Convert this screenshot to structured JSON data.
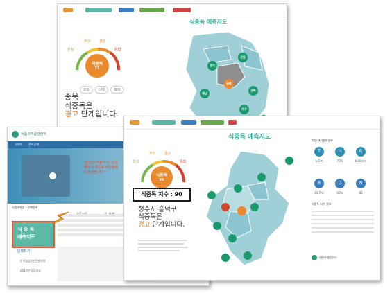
{
  "window_back": {
    "map_title": "식중독 예측지도",
    "gauge_labels": [
      "관심",
      "주의",
      "경고",
      "위험"
    ],
    "dial_text": "식중독",
    "dial_value": "71",
    "tabs": [
      "오늘",
      "내일",
      "모레"
    ],
    "region": "충북",
    "headline": "식중독은",
    "status": "경고",
    "status_tail": "단계입니다.",
    "nodes": [
      "강원",
      "경기",
      "충북",
      "충남",
      "경북",
      "대구",
      "울산"
    ]
  },
  "window_left": {
    "site_name": "식품의약품안전처",
    "nav": [
      "식약처",
      "정보공개"
    ],
    "banner_line1": "\"안전한 먹을거리, 건강",
    "banner_line2": "좋은 환경으로 국민행복",
    "banner_line3": "이끌겠습니다.\"",
    "tile_label1": "식 중 독",
    "tile_label2": "예측지도",
    "section_title": "식품의약품 / 정책정보",
    "news_tabs": [
      "보도자료",
      "공지사항"
    ],
    "alert_title": "알레르기",
    "links": [
      "한국농업인안전관리원",
      "2016년 업무보고"
    ]
  },
  "window_front": {
    "map_title": "식중독 예측지도",
    "gauge_labels": [
      "관심",
      "주의",
      "경고",
      "위험"
    ],
    "dial_text": "식중독",
    "dial_value": "90",
    "index_badge": "식중독 지수 : 90",
    "region": "청주시 흥덕구",
    "headline": "식중독은",
    "status": "경고",
    "status_tail": "단계입니다.",
    "env_title": "기상/대기환경정보",
    "env_values": [
      "1.5℃",
      "73%",
      "0.00mm"
    ],
    "env_values2": [
      "43.7℃",
      "62%",
      "83"
    ],
    "guide_title": "식중독 지수 정보",
    "footer": "식품의약품안전처"
  },
  "colors": {
    "map_fill": "#9fd0d8",
    "node_green": "#1a9a6c",
    "node_orange": "#ea8a2e",
    "node_red": "#d2462e",
    "accent": "#3aa99a"
  }
}
